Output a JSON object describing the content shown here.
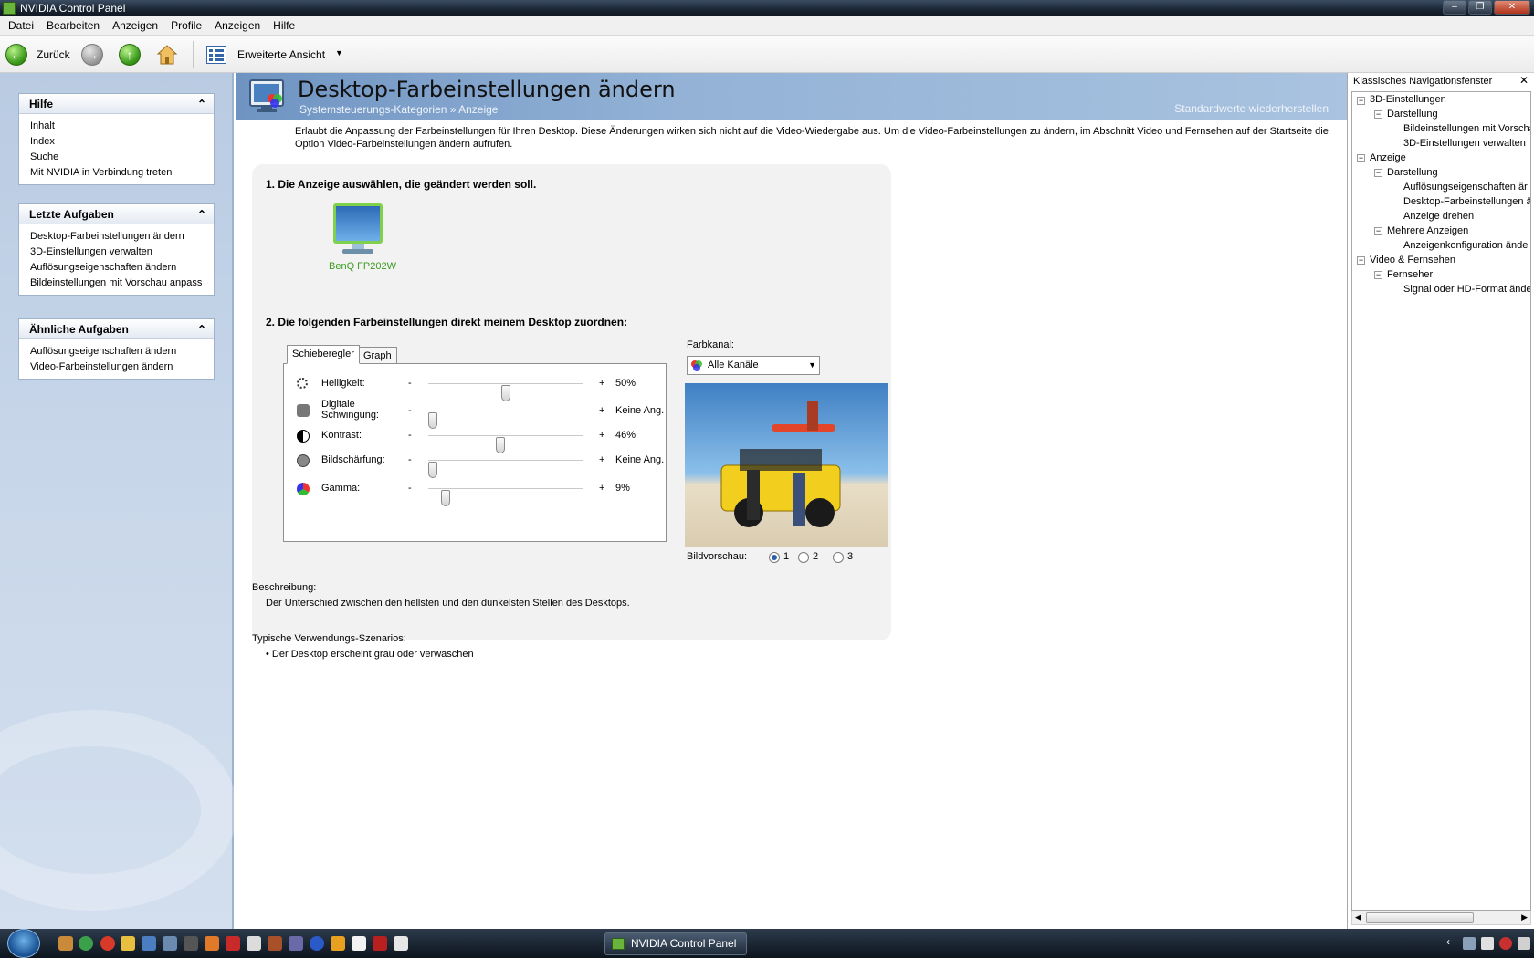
{
  "window": {
    "title": "NVIDIA Control Panel"
  },
  "menu": [
    "Datei",
    "Bearbeiten",
    "Anzeigen",
    "Profile",
    "Anzeigen",
    "Hilfe"
  ],
  "toolbar": {
    "back_label": "Zurück",
    "view_label": "Erweiterte Ansicht"
  },
  "left": {
    "hilfe": {
      "title": "Hilfe",
      "links": [
        "Inhalt",
        "Index",
        "Suche",
        "Mit NVIDIA in Verbindung treten"
      ]
    },
    "letzte": {
      "title": "Letzte Aufgaben",
      "links": [
        "Desktop-Farbeinstellungen ändern",
        "3D-Einstellungen verwalten",
        "Auflösungseigenschaften ändern",
        "Bildeinstellungen mit Vorschau anpass..."
      ]
    },
    "aehnliche": {
      "title": "Ähnliche Aufgaben",
      "links": [
        "Auflösungseigenschaften ändern",
        "Video-Farbeinstellungen ändern"
      ]
    }
  },
  "main": {
    "title": "Desktop-Farbeinstellungen ändern",
    "breadcrumb": "Systemsteuerungs-Kategorien  »  Anzeige",
    "restore": "Standardwerte wiederherstellen",
    "intro": "Erlaubt die Anpassung der Farbeinstellungen für Ihren Desktop. Diese Änderungen wirken sich nicht auf die Video-Wiedergabe aus. Um die Video-Farbeinstellungen zu ändern, im Abschnitt Video und Fernsehen auf der Startseite die Option Video-Farbeinstellungen ändern aufrufen.",
    "step1": "1. Die Anzeige auswählen, die geändert werden soll.",
    "monitor_name": "BenQ FP202W",
    "step2": "2. Die folgenden Farbeinstellungen direkt meinem Desktop zuordnen:",
    "tabs": [
      "Schieberegler",
      "Graph"
    ],
    "sliders": [
      {
        "label": "Helligkeit:",
        "value": "50%",
        "position": 0.5
      },
      {
        "label": "Digitale Schwingung:",
        "value": "Keine Ang.",
        "position": 0.0
      },
      {
        "label": "Kontrast:",
        "value": "46%",
        "position": 0.46
      },
      {
        "label": "Bildschärfung:",
        "value": "Keine Ang.",
        "position": 0.0
      },
      {
        "label": "Gamma:",
        "value": "9%",
        "position": 0.09
      }
    ],
    "minus": "-",
    "plus": "+",
    "farbkanal_label": "Farbkanal:",
    "farbkanal_value": "Alle Kanäle",
    "bildvorschau_label": "Bildvorschau:",
    "preview_options": [
      "1",
      "2",
      "3"
    ],
    "preview_selected": "1",
    "beschreibung_label": "Beschreibung:",
    "beschreibung_text": "Der Unterschied zwischen den hellsten und den dunkelsten Stellen des Desktops.",
    "szenarios_label": "Typische Verwendungs-Szenarios:",
    "szenarios": [
      "• Der Desktop erscheint grau oder verwaschen"
    ]
  },
  "right": {
    "title": "Klassisches Navigationsfenster",
    "tree": [
      "3D-Einstellungen",
      "Darstellung",
      "Bildeinstellungen mit Vorscha",
      "3D-Einstellungen verwalten",
      "Anzeige",
      "Darstellung",
      "Auflösungseigenschaften är",
      "Desktop-Farbeinstellungen ä",
      "Anzeige drehen",
      "Mehrere Anzeigen",
      "Anzeigenkonfiguration ände",
      "Video & Fernsehen",
      "Fernseher",
      "Signal oder HD-Format ände"
    ]
  },
  "taskbar": {
    "active_window": "NVIDIA Control Panel"
  },
  "colors": {
    "accent": "#6f94c2",
    "nvidia_green": "#76b900",
    "left_panel": "#c9d7ea"
  }
}
